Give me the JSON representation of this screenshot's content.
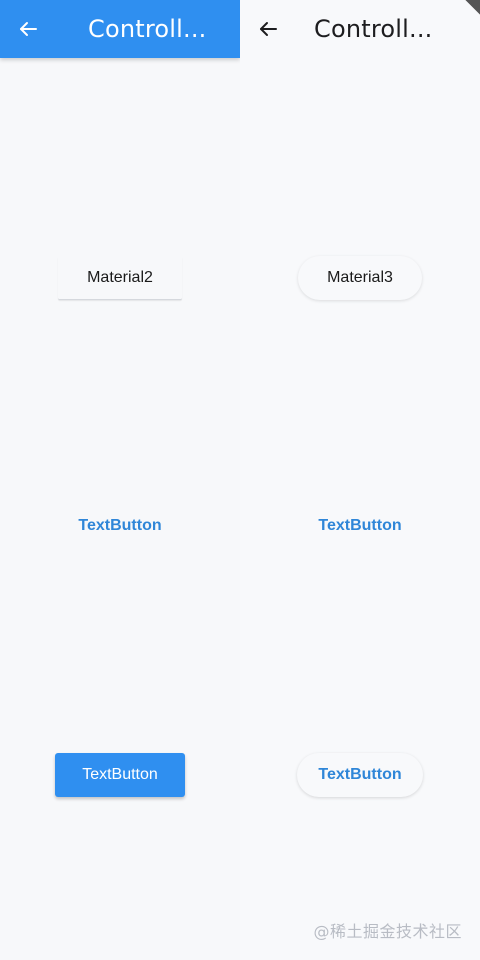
{
  "left_panel": {
    "appbar": {
      "back_icon": "arrow-back-icon",
      "title": "Controll..."
    },
    "buttons": [
      {
        "label": "Material2"
      },
      {
        "label": "TextButton"
      },
      {
        "label": "TextButton"
      }
    ]
  },
  "right_panel": {
    "appbar": {
      "back_icon": "arrow-back-icon",
      "title": "Controll..."
    },
    "buttons": [
      {
        "label": "Material3"
      },
      {
        "label": "TextButton"
      },
      {
        "label": "TextButton"
      }
    ]
  },
  "watermark": "@稀土掘金技术社区",
  "colors": {
    "primary": "#2f8ff0",
    "text_button": "#2f86d8",
    "background": "#f7f8fa"
  }
}
